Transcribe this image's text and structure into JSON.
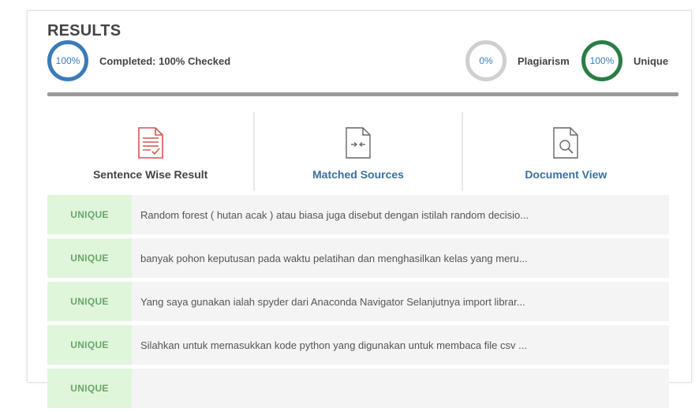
{
  "header": {
    "title": "RESULTS"
  },
  "stats": {
    "completed": {
      "percent_text": "100%",
      "label": "Completed: 100% Checked",
      "color": "#3a7bb8"
    },
    "plagiarism": {
      "percent_text": "0%",
      "label": "Plagiarism",
      "color": "#cfcfcf"
    },
    "unique": {
      "percent_text": "100%",
      "label": "Unique",
      "color": "#2a7d46"
    }
  },
  "progress": {
    "value_percent": 100
  },
  "tabs": [
    {
      "label": "Sentence Wise Result",
      "icon": "report-document-icon",
      "active": true
    },
    {
      "label": "Matched Sources",
      "icon": "compare-document-icon",
      "active": false
    },
    {
      "label": "Document View",
      "icon": "document-search-icon",
      "active": false
    }
  ],
  "results": [
    {
      "status": "UNIQUE",
      "text": "Random forest ( hutan acak ) atau biasa juga disebut dengan istilah random decisio..."
    },
    {
      "status": "UNIQUE",
      "text": "banyak pohon keputusan pada waktu pelatihan dan menghasilkan kelas yang meru..."
    },
    {
      "status": "UNIQUE",
      "text": "Yang saya gunakan ialah spyder dari Anaconda Navigator Selanjutnya import librar..."
    },
    {
      "status": "UNIQUE",
      "text": "Silahkan untuk memasukkan kode python yang digunakan untuk membaca file csv ..."
    },
    {
      "status": "UNIQUE",
      "text": ""
    }
  ],
  "colors": {
    "badge_bg": "#dff6da",
    "badge_text": "#6aa56a",
    "link_blue": "#3a6fa0",
    "icon_red": "#d9534f"
  }
}
